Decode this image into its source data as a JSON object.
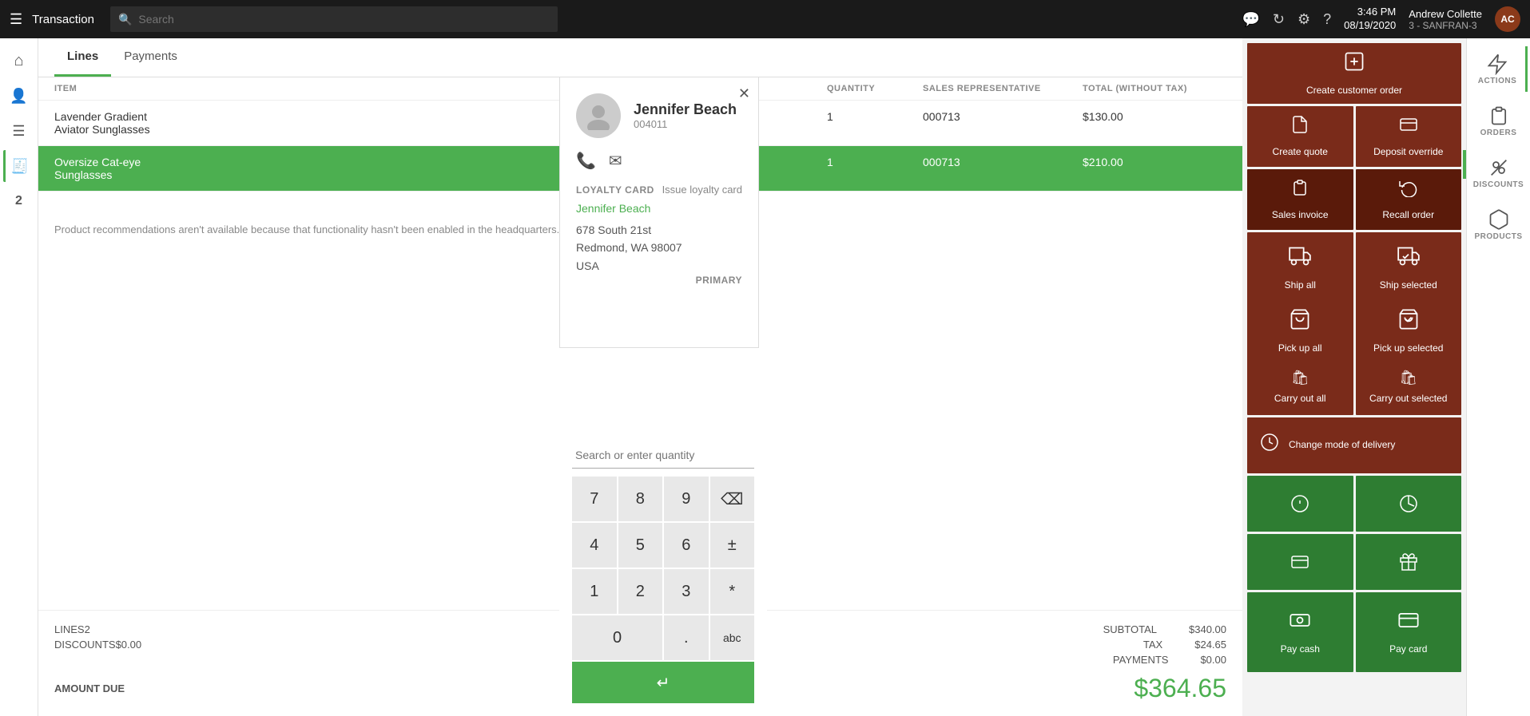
{
  "topbar": {
    "hamburger": "☰",
    "title": "Transaction",
    "search_placeholder": "Search",
    "time": "3:46 PM",
    "date": "08/19/2020",
    "user": "Andrew Collette",
    "store": "3 - SANFRAN-3",
    "avatar_initials": "AC"
  },
  "sidebar": {
    "items": [
      {
        "icon": "⌂",
        "label": "home",
        "active": false
      },
      {
        "icon": "👤",
        "label": "customers",
        "active": false
      },
      {
        "icon": "☰",
        "label": "menu",
        "active": false
      },
      {
        "icon": "🧾",
        "label": "transactions",
        "active": true
      },
      {
        "icon": "2",
        "label": "count",
        "active": false
      }
    ]
  },
  "tabs": [
    {
      "label": "Lines",
      "active": true
    },
    {
      "label": "Payments",
      "active": false
    }
  ],
  "table": {
    "headers": [
      "ITEM",
      "QUANTITY",
      "SALES REPRESENTATIVE",
      "TOTAL (WITHOUT TAX)"
    ],
    "rows": [
      {
        "item": "Lavender Gradient\nAviator Sunglasses",
        "quantity": "1",
        "rep": "000713",
        "total": "$130.00",
        "selected": false
      },
      {
        "item": "Oversize Cat-eye\nSunglasses",
        "quantity": "1",
        "rep": "000713",
        "total": "$210.00",
        "selected": true
      }
    ]
  },
  "product_rec_msg": "Product recommendations aren't available because that functionality hasn't been enabled in the headquarters.",
  "footer": {
    "lines_label": "LINES",
    "lines_value": "2",
    "discounts_label": "DISCOUNTS",
    "discounts_value": "$0.00",
    "subtotal_label": "SUBTOTAL",
    "subtotal_value": "$340.00",
    "tax_label": "TAX",
    "tax_value": "$24.65",
    "payments_label": "PAYMENTS",
    "payments_value": "$0.00",
    "amount_due_label": "AMOUNT DUE",
    "amount_due_value": "$364.65"
  },
  "customer": {
    "name": "Jennifer Beach",
    "id": "004011",
    "link_name": "Jennifer Beach",
    "address_line1": "678 South 21st",
    "address_line2": "Redmond, WA 98007",
    "address_line3": "USA",
    "loyalty_card_label": "LOYALTY CARD",
    "issue_loyalty_label": "Issue loyalty card",
    "primary_label": "PRIMARY"
  },
  "keypad": {
    "search_placeholder": "Search or enter quantity",
    "buttons": [
      "7",
      "8",
      "9",
      "⌫",
      "4",
      "5",
      "6",
      "±",
      "1",
      "2",
      "3",
      "*",
      "0",
      ".",
      "abc"
    ],
    "enter_label": "↵"
  },
  "tiles": {
    "create_customer_order": "Create customer order",
    "create_quote": "Create quote",
    "deposit_override": "Deposit override",
    "sales_invoice": "Sales invoice",
    "recall_order": "Recall order",
    "ship_all": "Ship all",
    "ship_selected": "Ship selected",
    "pick_up_all": "Pick up all",
    "pick_up_selected": "Pick up selected",
    "carry_out_all": "Carry out all",
    "carry_out_selected": "Carry out selected",
    "change_mode_delivery": "Change mode of delivery",
    "pay_cash": "Pay cash",
    "pay_card": "Pay card",
    "actions_label": "ACTIONS",
    "orders_label": "ORDERS",
    "discounts_label": "DISCOUNTS",
    "products_label": "PRODUCTS"
  }
}
